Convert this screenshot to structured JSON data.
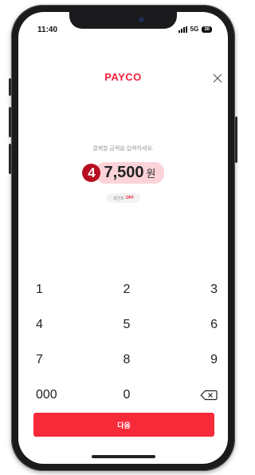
{
  "status": {
    "time": "11:40",
    "network": "5G",
    "battery": "30"
  },
  "header": {
    "brand": "PAYCO",
    "close_icon": "close-icon"
  },
  "payment": {
    "prompt": "결제할 금액을 입력하세요.",
    "step_badge": "4",
    "amount": "7,500",
    "currency": "원",
    "point_label": "포인트",
    "point_state": "OFF"
  },
  "keypad": {
    "rows": [
      [
        "1",
        "2",
        "3"
      ],
      [
        "4",
        "5",
        "6"
      ],
      [
        "7",
        "8",
        "9"
      ],
      [
        "000",
        "0",
        "backspace-icon"
      ]
    ]
  },
  "footer": {
    "next_label": "다음"
  },
  "colors": {
    "brand": "#f0203a",
    "button": "#f62a38",
    "badge": "#b70d1f",
    "amount_highlight": "#fbd3d9"
  }
}
